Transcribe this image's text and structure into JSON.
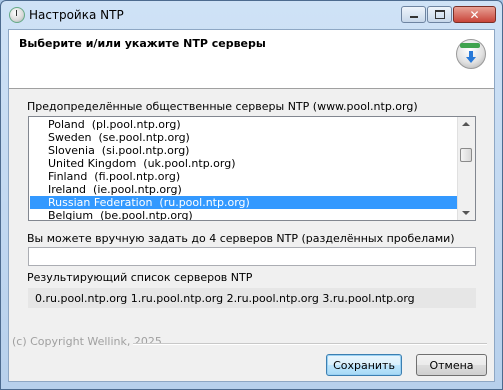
{
  "window": {
    "title": "Настройка NTP"
  },
  "header": {
    "title": "Выберите и/или укажите NTP серверы"
  },
  "predefined": {
    "label": "Предопределённые общественные серверы NTP (www.pool.ntp.org)",
    "items": [
      "Poland  (pl.pool.ntp.org)",
      "Sweden  (se.pool.ntp.org)",
      "Slovenia  (si.pool.ntp.org)",
      "United Kingdom  (uk.pool.ntp.org)",
      "Finland  (fi.pool.ntp.org)",
      "Ireland  (ie.pool.ntp.org)",
      "Russian Federation  (ru.pool.ntp.org)",
      "Belgium  (be.pool.ntp.org)"
    ],
    "selected_index": 6
  },
  "manual": {
    "label": "Вы можете вручную задать до 4 серверов NTP (разделённых пробелами)",
    "value": ""
  },
  "result": {
    "label": "Результирующий список серверов NTP",
    "value": "0.ru.pool.ntp.org 1.ru.pool.ntp.org 2.ru.pool.ntp.org 3.ru.pool.ntp.org"
  },
  "footer": {
    "copyright": "(c) Copyright Wellink, 2025",
    "save_label": "Сохранить",
    "cancel_label": "Отмена"
  }
}
